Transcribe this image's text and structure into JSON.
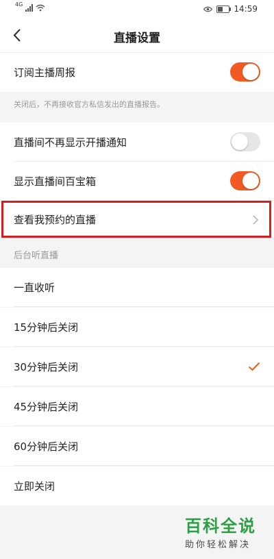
{
  "status_bar": {
    "network": "4G",
    "time": "14:59"
  },
  "header": {
    "title": "直播设置"
  },
  "settings": {
    "weekly_report": {
      "label": "订阅主播周报",
      "enabled": true
    },
    "weekly_report_hint": "关闭后，不再接收官方私信发出的直播报告。",
    "hide_start_notice": {
      "label": "直播间不再显示开播通知",
      "enabled": false
    },
    "show_treasure_box": {
      "label": "显示直播间百宝箱",
      "enabled": true
    },
    "my_reservations": {
      "label": "查看我预约的直播"
    }
  },
  "background_listen": {
    "title": "后台听直播",
    "options": [
      {
        "label": "一直收听",
        "selected": false
      },
      {
        "label": "15分钟后关闭",
        "selected": false
      },
      {
        "label": "30分钟后关闭",
        "selected": true
      },
      {
        "label": "45分钟后关闭",
        "selected": false
      },
      {
        "label": "60分钟后关闭",
        "selected": false
      },
      {
        "label": "立即关闭",
        "selected": false
      }
    ]
  },
  "watermark": {
    "main": "百科全说",
    "sub": "助你轻松解决"
  },
  "colors": {
    "accent": "#f15a22",
    "highlight": "#d21f1f",
    "watermark": "#2e9e46"
  }
}
